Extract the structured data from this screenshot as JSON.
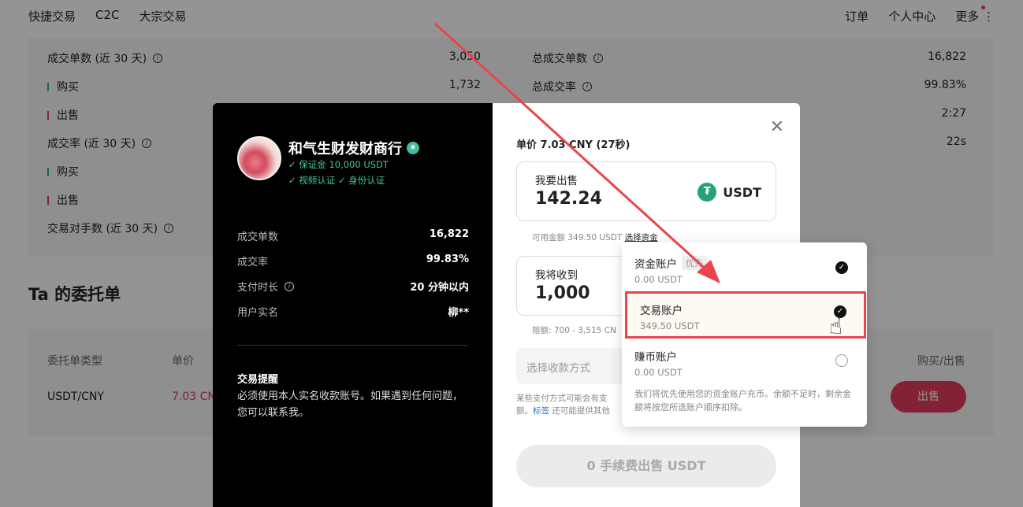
{
  "topnav": {
    "left": [
      "快捷交易",
      "C2C",
      "大宗交易"
    ],
    "right": [
      "订单",
      "个人中心",
      "更多"
    ]
  },
  "stats_left": [
    {
      "label": "成交单数 (近 30 天)",
      "value": "3,050",
      "info": true
    },
    {
      "label": "购买",
      "value": "1,732",
      "bar": "g"
    },
    {
      "label": "出售",
      "value": "",
      "bar": "r"
    },
    {
      "label": "成交率 (近 30 天)",
      "value": "",
      "info": true
    },
    {
      "label": "购买",
      "value": "",
      "bar": "g"
    },
    {
      "label": "出售",
      "value": "",
      "bar": "r"
    },
    {
      "label": "交易对手数 (近 30 天)",
      "value": "",
      "info": true
    }
  ],
  "stats_right": [
    {
      "label": "总成交单数",
      "value": "16,822"
    },
    {
      "label": "总成交率",
      "value": "99.83%"
    },
    {
      "label": "",
      "value": "2:27"
    },
    {
      "label": "",
      "value": "22s"
    }
  ],
  "section_title": "Ta 的委托单",
  "table": {
    "headers": [
      "委托单类型",
      "单价",
      "购买/出售"
    ],
    "row": {
      "type": "USDT/CNY",
      "price": "7.03 CN",
      "action": "出售"
    }
  },
  "modal": {
    "merchant_name": "和气生财发财商行",
    "deposit": "✓ 保证金 10,000 USDT",
    "verify": "✓ 视频认证   ✓ 身份认证",
    "stats": [
      {
        "k": "成交单数",
        "v": "16,822"
      },
      {
        "k": "成交率",
        "v": "99.83%"
      },
      {
        "k": "支付时长",
        "v": "20 分钟以内",
        "info": true
      },
      {
        "k": "用户实名",
        "v": "柳**"
      }
    ],
    "remind_title": "交易提醒",
    "remind_text": "必须使用本人实名收款账号。如果遇到任何问题，您可以联系我。",
    "unit_price": "单价 7.03 CNY (27秒)",
    "sell_label": "我要出售",
    "sell_amount": "142.24",
    "coin": "USDT",
    "available": "可用金额 349.50 USDT",
    "choose_asset": "选择资金",
    "receive_label": "我将收到",
    "receive_amount": "1,000",
    "limit": "限额: 700 - 3,515 CN",
    "payment_placeholder": "选择收款方式",
    "note_line1": "某些支付方式可能会有支",
    "note_line2a": "额。",
    "note_link": "标签",
    "note_line2b": " 还可能提供其他",
    "submit": "0 手续费出售 USDT"
  },
  "dropdown": {
    "options": [
      {
        "name": "资金账户",
        "tag": "优先",
        "balance": "0.00 USDT",
        "state": "checked"
      },
      {
        "name": "交易账户",
        "tag": "",
        "balance": "349.50 USDT",
        "state": "checked"
      },
      {
        "name": "赚币账户",
        "tag": "",
        "balance": "0.00 USDT",
        "state": "unchecked"
      }
    ],
    "note": "我们将优先使用您的资金账户充币。余额不足时，剩余金额将按您所选账户顺序扣除。"
  },
  "colors": {
    "accent_red": "#e9454c",
    "sell_red": "#e23c5a",
    "green": "#2bb27c"
  }
}
